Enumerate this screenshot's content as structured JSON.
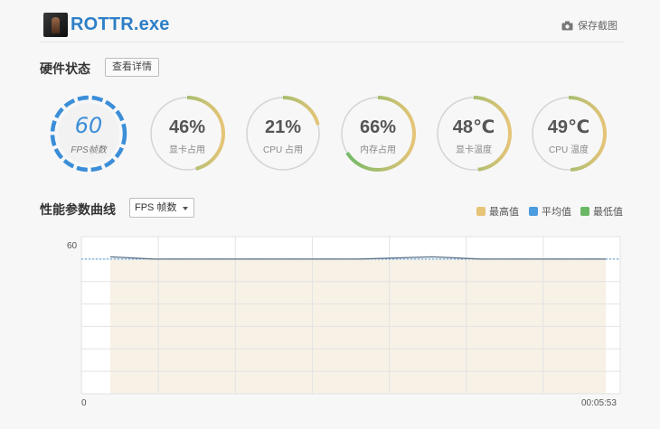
{
  "app": {
    "title": "ROTTR.exe",
    "icon": "game-icon"
  },
  "toolbar": {
    "screenshot_label": "保存截图",
    "screenshot_icon": "camera-icon"
  },
  "hardware": {
    "title": "硬件状态",
    "detail_button": "查看详情",
    "gauges": [
      {
        "value": "60",
        "label": "FPS帧数",
        "percent": 1.0,
        "style": "dashed"
      },
      {
        "value": "46%",
        "label": "显卡占用",
        "percent": 0.46
      },
      {
        "value": "21%",
        "label": "CPU 占用",
        "percent": 0.21
      },
      {
        "value": "66%",
        "label": "内存占用",
        "percent": 0.66
      },
      {
        "value": "48℃",
        "label": "显卡温度",
        "percent": 0.48
      },
      {
        "value": "49℃",
        "label": "CPU 温度",
        "percent": 0.49
      }
    ]
  },
  "performance": {
    "title": "性能参数曲线",
    "metric_select": "FPS 帧数",
    "legend": [
      {
        "label": "最高值",
        "color": "#e6c478"
      },
      {
        "label": "平均值",
        "color": "#4c9ce0"
      },
      {
        "label": "最低值",
        "color": "#6ab866"
      }
    ]
  },
  "chart_data": {
    "type": "line",
    "y_tick_labels": [
      "60"
    ],
    "x_start_label": "0",
    "x_end_label": "00:05:53",
    "ylim": [
      0,
      70
    ],
    "average_line": 60,
    "x": [
      0,
      0.09,
      0.5,
      0.65,
      0.75,
      1.0
    ],
    "values": [
      61,
      60,
      60,
      61,
      60,
      60
    ]
  },
  "colors": {
    "accent": "#2d7fc7",
    "gauge_green": "#6ab866",
    "gauge_yellow": "#e6c478",
    "fps_blue": "#3b8ed8"
  }
}
